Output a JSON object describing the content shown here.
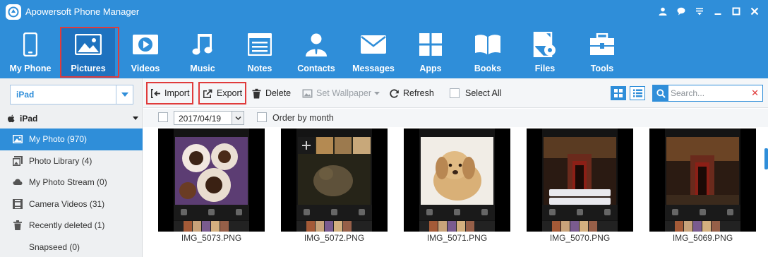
{
  "app": {
    "title": "Apowersoft Phone Manager"
  },
  "nav": {
    "items": [
      {
        "label": "My Phone",
        "icon": "phone-icon"
      },
      {
        "label": "Pictures",
        "icon": "picture-icon",
        "active": true
      },
      {
        "label": "Videos",
        "icon": "video-icon"
      },
      {
        "label": "Music",
        "icon": "music-note-icon"
      },
      {
        "label": "Notes",
        "icon": "notes-icon"
      },
      {
        "label": "Contacts",
        "icon": "contact-person-icon"
      },
      {
        "label": "Messages",
        "icon": "envelope-icon"
      },
      {
        "label": "Apps",
        "icon": "apps-grid-icon"
      },
      {
        "label": "Books",
        "icon": "book-icon"
      },
      {
        "label": "Files",
        "icon": "file-gear-icon"
      },
      {
        "label": "Tools",
        "icon": "toolbox-icon"
      }
    ]
  },
  "device": {
    "selected": "iPad",
    "header": "iPad"
  },
  "sidebar": {
    "items": [
      {
        "label": "My Photo (970)",
        "icon": "photo-icon",
        "active": true
      },
      {
        "label": "Photo Library (4)",
        "icon": "photo-library-icon"
      },
      {
        "label": "My Photo Stream (0)",
        "icon": "cloud-stream-icon"
      },
      {
        "label": "Camera Videos (31)",
        "icon": "film-icon"
      },
      {
        "label": "Recently deleted (1)",
        "icon": "trash-icon"
      },
      {
        "label": "Snapseed (0)",
        "icon": ""
      }
    ]
  },
  "toolbar": {
    "import": "Import",
    "export": "Export",
    "delete": "Delete",
    "set_wallpaper": "Set Wallpaper",
    "refresh": "Refresh",
    "select_all": "Select All",
    "search_placeholder": "Search..."
  },
  "filter": {
    "date": "2017/04/19",
    "order_label": "Order by month"
  },
  "photos": [
    {
      "name": "IMG_5073.PNG"
    },
    {
      "name": "IMG_5072.PNG"
    },
    {
      "name": "IMG_5071.PNG"
    },
    {
      "name": "IMG_5070.PNG"
    },
    {
      "name": "IMG_5069.PNG"
    }
  ],
  "colors": {
    "header_blue": "#2f8ed9",
    "active_blue": "#1e72bf",
    "highlight_red": "#e03b3b"
  }
}
